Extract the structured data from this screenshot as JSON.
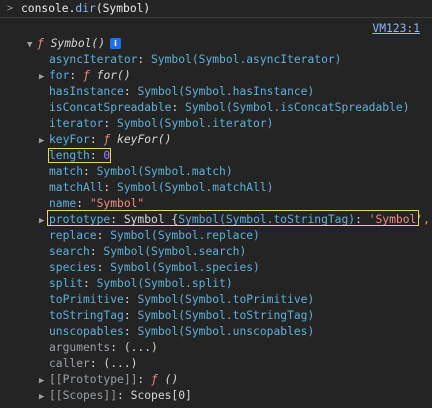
{
  "input": {
    "prompt": ">",
    "command_prefix": "console.",
    "command_fn": "dir",
    "command_args": "(Symbol)"
  },
  "source_link": "VM123:1",
  "root": {
    "toggle": "▼",
    "f": "ƒ",
    "name": "Symbol()",
    "info": "i"
  },
  "props": [
    {
      "key": "asyncIterator",
      "sep": ": ",
      "value": "Symbol(Symbol.asyncIterator)",
      "kind": "sym"
    },
    {
      "key": "for",
      "sep": ": ",
      "f": "ƒ",
      "value": "for()",
      "kind": "fn",
      "toggle": "▶"
    },
    {
      "key": "hasInstance",
      "sep": ": ",
      "value": "Symbol(Symbol.hasInstance)",
      "kind": "sym"
    },
    {
      "key": "isConcatSpreadable",
      "sep": ": ",
      "value": "Symbol(Symbol.isConcatSpreadable)",
      "kind": "sym"
    },
    {
      "key": "iterator",
      "sep": ": ",
      "value": "Symbol(Symbol.iterator)",
      "kind": "sym"
    },
    {
      "key": "keyFor",
      "sep": ": ",
      "f": "ƒ",
      "value": "keyFor()",
      "kind": "fn",
      "toggle": "▶"
    },
    {
      "key": "length",
      "sep": ": ",
      "value": "0",
      "kind": "num",
      "highlight": true
    },
    {
      "key": "match",
      "sep": ": ",
      "value": "Symbol(Symbol.match)",
      "kind": "sym"
    },
    {
      "key": "matchAll",
      "sep": ": ",
      "value": "Symbol(Symbol.matchAll)",
      "kind": "sym"
    },
    {
      "key": "name",
      "sep": ": ",
      "value": "\"Symbol\"",
      "kind": "str"
    },
    {
      "key": "prototype",
      "sep": ": ",
      "value": "Symbol {",
      "value2": "Symbol(Symbol.toStringTag)",
      "value3": ": ",
      "value4": "'Symbol',",
      "kind": "proto",
      "toggle": "▶",
      "highlight_wide": true
    },
    {
      "key": "replace",
      "sep": ": ",
      "value": "Symbol(Symbol.replace)",
      "kind": "sym"
    },
    {
      "key": "search",
      "sep": ": ",
      "value": "Symbol(Symbol.search)",
      "kind": "sym"
    },
    {
      "key": "species",
      "sep": ": ",
      "value": "Symbol(Symbol.species)",
      "kind": "sym"
    },
    {
      "key": "split",
      "sep": ": ",
      "value": "Symbol(Symbol.split)",
      "kind": "sym"
    },
    {
      "key": "toPrimitive",
      "sep": ": ",
      "value": "Symbol(Symbol.toPrimitive)",
      "kind": "sym"
    },
    {
      "key": "toStringTag",
      "sep": ": ",
      "value": "Symbol(Symbol.toStringTag)",
      "kind": "sym"
    },
    {
      "key": "unscopables",
      "sep": ": ",
      "value": "Symbol(Symbol.unscopables)",
      "kind": "sym"
    },
    {
      "key": "arguments",
      "sep": ": ",
      "value": "(...)",
      "kind": "lazy",
      "dim": true
    },
    {
      "key": "caller",
      "sep": ": ",
      "value": "(...)",
      "kind": "lazy",
      "dim": true
    },
    {
      "key": "[[Prototype]]",
      "sep": ": ",
      "f": "ƒ",
      "value": "()",
      "kind": "fn",
      "toggle": "▶",
      "dim": true
    },
    {
      "key": "[[Scopes]]",
      "sep": ": ",
      "value": "Scopes[0]",
      "kind": "plain",
      "toggle": "▶",
      "dim": true
    }
  ],
  "colors": {
    "background": "#242424",
    "key": "#5db0d7",
    "string": "#f28b82",
    "number": "#9980ff",
    "highlight_box": "#e5d94a",
    "link": "#8ab4f8"
  }
}
